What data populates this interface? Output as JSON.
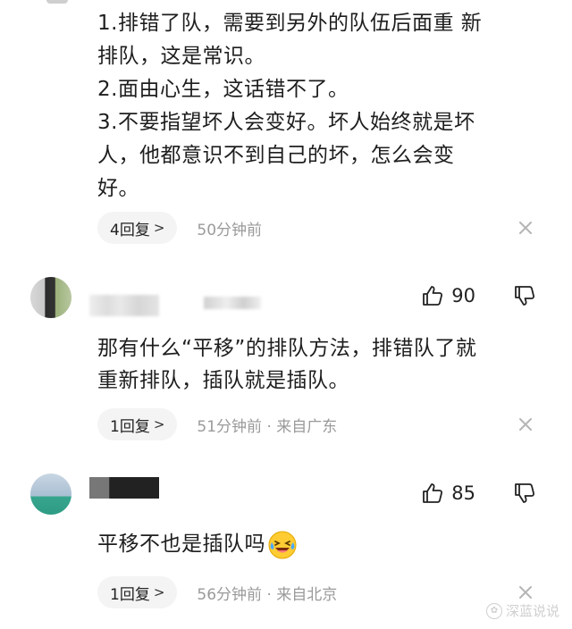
{
  "comments": [
    {
      "text_lines": [
        "1.排错了队，需要到另外的队伍后面重 新",
        "排队，这是常识。",
        "2.面由心生，这话错不了。",
        "3.不要指望坏人会变好。坏人始终就是坏",
        "人，他都意识不到自己的坏，怎么会变",
        "好。"
      ],
      "reply_label": "4回复",
      "reply_chevron": ">",
      "meta": "50分钟前",
      "close_icon": "close-icon"
    },
    {
      "likes": "90",
      "text_lines": [
        "那有什么“平移”的排队方法，排错队了就",
        "重新排队，插队就是插队。"
      ],
      "reply_label": "1回复",
      "reply_chevron": ">",
      "meta": "51分钟前 · 来自广东",
      "close_icon": "close-icon"
    },
    {
      "likes": "85",
      "text": "平移不也是插队吗",
      "emoji": "laughing-crying-emoji",
      "reply_label": "1回复",
      "reply_chevron": ">",
      "meta": "56分钟前 · 来自北京",
      "close_icon": "close-icon"
    }
  ],
  "watermark": {
    "text": "深蓝说说",
    "icon": "watermark-logo-icon"
  },
  "icons": {
    "like": "thumbs-up-icon",
    "dislike": "thumbs-down-icon"
  },
  "colors": {
    "text": "#1e1e1e",
    "meta": "#9a9a9a",
    "pill_bg": "#f4f4f4"
  }
}
